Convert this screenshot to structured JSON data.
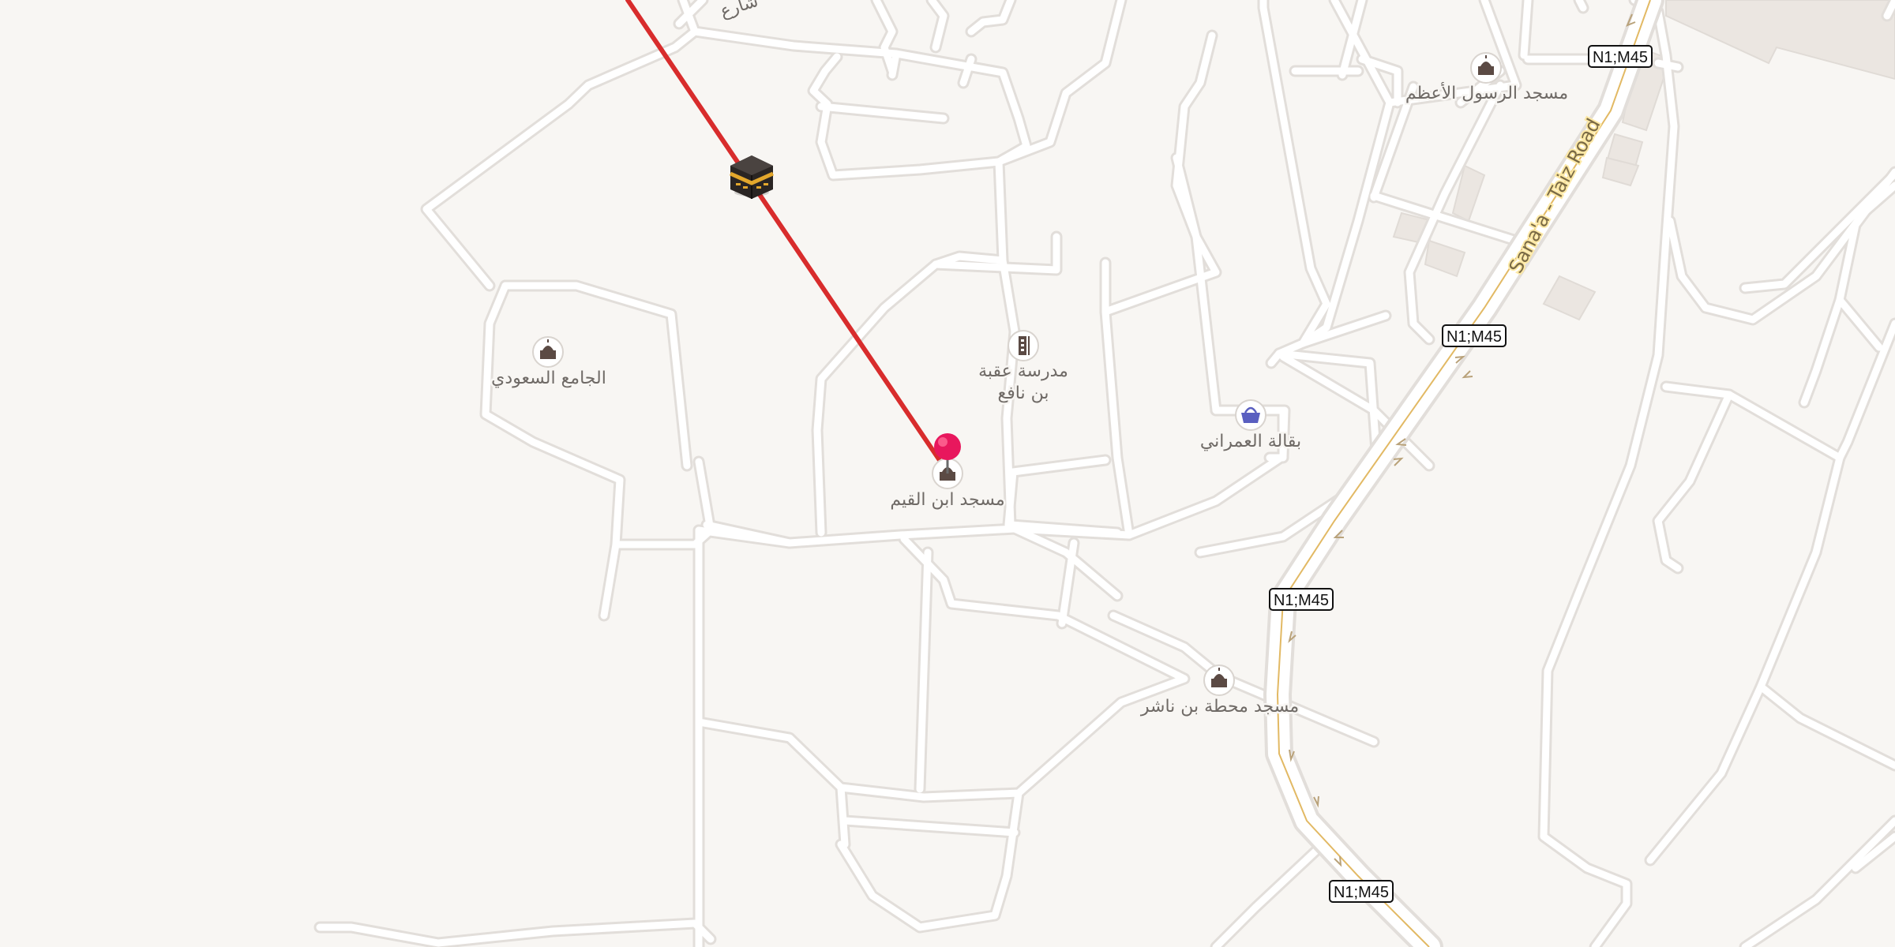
{
  "map": {
    "pois": {
      "mosque_rasul": "مسجد الرسول الأعظم",
      "saudi_mosque": "الجامع السعودي",
      "school_uqba": [
        "مدرسة عقبة",
        "بن نافع"
      ],
      "grocery_umrani": "بقالة العمراني",
      "mosque_ibn_qayyim": "مسجد ابن القيم",
      "mosque_mahatta": "مسجد محطة بن ناشر",
      "street_partial": "شارع"
    },
    "road_shield": "N1;M45",
    "road_name": "Sana'a - Taiz Road",
    "icons": {
      "mosque": "mosque-icon",
      "school": "school-icon",
      "shop": "shopping-basket-icon",
      "qibla": "kaaba-icon",
      "location": "location-pin-icon"
    },
    "colors": {
      "background": "#f8f6f3",
      "highway_fill": "#fde5a3",
      "highway_casing": "#e5c47a",
      "qibla_line": "#d82c2c",
      "location_pin": "#e8175d",
      "poi_icon": "#5b4a44",
      "shop_icon": "#5a5fc0"
    }
  }
}
